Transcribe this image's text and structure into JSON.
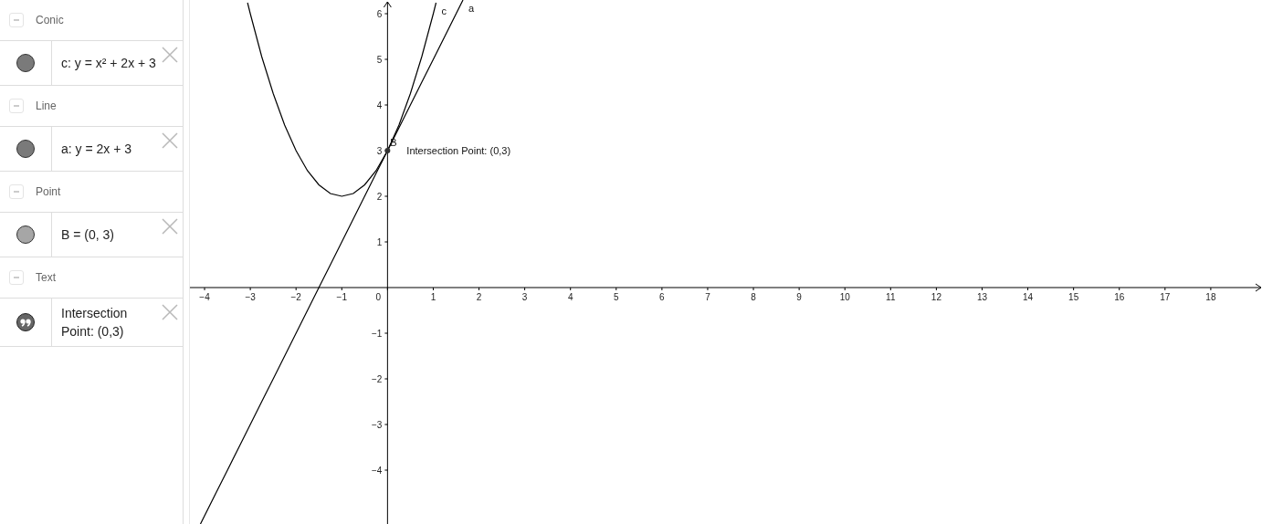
{
  "algebra_view": {
    "groups": [
      {
        "title": "Conic",
        "expanded": true,
        "items": [
          {
            "kind": "object",
            "color": "#7a7a7a",
            "expression": "c: y = x² + 2x + 3"
          }
        ]
      },
      {
        "title": "Line",
        "expanded": true,
        "items": [
          {
            "kind": "object",
            "color": "#7a7a7a",
            "expression": "a: y = 2x + 3"
          }
        ]
      },
      {
        "title": "Point",
        "expanded": true,
        "items": [
          {
            "kind": "object",
            "color": "#a6a6a6",
            "expression": "B = (0, 3)"
          }
        ]
      },
      {
        "title": "Text",
        "expanded": true,
        "items": [
          {
            "kind": "text",
            "expression": "Intersection Point: (0,3)"
          }
        ]
      }
    ]
  },
  "graphics_view": {
    "chart_data": {
      "type": "line",
      "x": [
        -4.09,
        -4,
        -3.75,
        -3.5,
        -3.25,
        -3.06,
        -3,
        -2.75,
        -2.5,
        -2.25,
        -2,
        -1.75,
        -1.5,
        -1.25,
        -1,
        -0.75,
        -0.5,
        -0.25,
        0,
        0.25,
        0.5,
        0.75,
        1,
        1.06,
        1.25,
        1.5,
        1.65
      ],
      "series": [
        {
          "name": "c",
          "color": "#000000",
          "values": [
            null,
            null,
            null,
            null,
            null,
            6.24,
            6,
            5.06,
            4.25,
            3.56,
            3,
            2.56,
            2.25,
            2.06,
            2,
            2.06,
            2.25,
            2.56,
            3,
            3.56,
            4.25,
            5.06,
            6,
            6.24,
            null,
            null,
            null
          ]
        },
        {
          "name": "a",
          "color": "#000000",
          "values": [
            -5.18,
            -5,
            -4.5,
            -4,
            -3.5,
            -3.12,
            -3,
            -2.5,
            -2,
            -1.5,
            -1,
            -0.5,
            0,
            0.5,
            1,
            1.5,
            2,
            2.5,
            3,
            3.5,
            4,
            4.5,
            5,
            5.12,
            5.5,
            6,
            6.3
          ]
        }
      ],
      "xlim": [
        -4.32,
        19.14
      ],
      "ylim": [
        -5.18,
        6.3
      ],
      "xticks": [
        {
          "value": -4,
          "label": "−4"
        },
        {
          "value": -3,
          "label": "−3"
        },
        {
          "value": -2,
          "label": "−2"
        },
        {
          "value": -1,
          "label": "−1"
        },
        {
          "value": 0,
          "label": "0"
        },
        1,
        2,
        3,
        4,
        5,
        6,
        7,
        8,
        9,
        10,
        11,
        12,
        13,
        14,
        15,
        16,
        17,
        18
      ],
      "yticks": [
        {
          "value": -4,
          "label": "−4"
        },
        {
          "value": -3,
          "label": "−3"
        },
        {
          "value": -2,
          "label": "−2"
        },
        {
          "value": -1,
          "label": "−1"
        },
        1,
        2,
        3,
        4,
        5,
        6
      ],
      "annotations": [
        {
          "text": "B",
          "x": 0,
          "y": 3
        }
      ]
    },
    "caption": "Intersection Point: (0,3)"
  }
}
